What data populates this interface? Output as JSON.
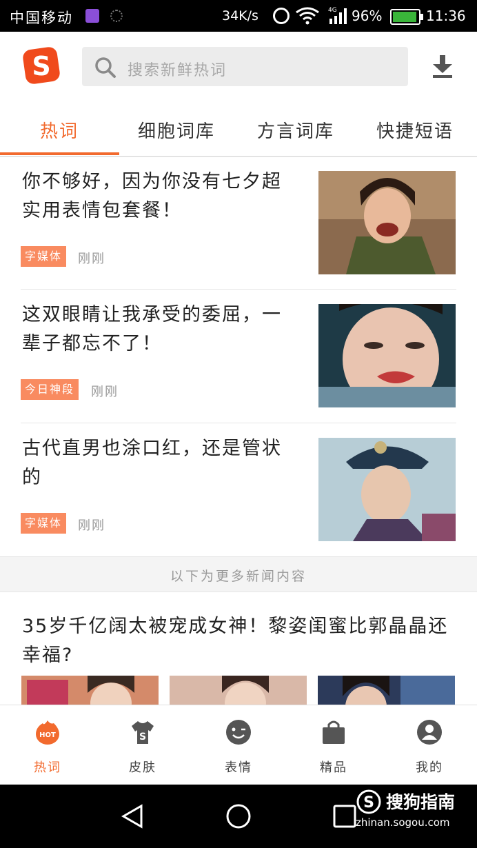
{
  "status_bar": {
    "carrier": "中国移动",
    "speed": "34K/s",
    "network": "4G",
    "battery": "96%",
    "time": "11:36"
  },
  "header": {
    "logo_letter": "S",
    "search_placeholder": "搜索新鲜热词"
  },
  "tabs": [
    "热词",
    "细胞词库",
    "方言词库",
    "快捷短语"
  ],
  "news": [
    {
      "title": "你不够好，因为你没有七夕超实用表情包套餐！",
      "tag": "字媒体",
      "time": "刚刚"
    },
    {
      "title": "这双眼睛让我承受的委屈，一辈子都忘不了！",
      "tag": "今日神段",
      "time": "刚刚"
    },
    {
      "title": "古代直男也涂口红，还是管状的",
      "tag": "字媒体",
      "time": "刚刚"
    }
  ],
  "more_label": "以下为更多新闻内容",
  "article2": {
    "title": "35岁千亿阔太被宠成女神！黎姿闺蜜比郭晶晶还幸福?"
  },
  "bottom_nav": [
    {
      "label": "热词",
      "icon": "hot-icon",
      "badge": "HOT"
    },
    {
      "label": "皮肤",
      "icon": "skin-tshirt-icon"
    },
    {
      "label": "表情",
      "icon": "emoji-wink-icon"
    },
    {
      "label": "精品",
      "icon": "shopping-bag-icon"
    },
    {
      "label": "我的",
      "icon": "profile-icon"
    }
  ],
  "watermark": {
    "name": "搜狗指南",
    "url": "zhinan.sogou.com"
  },
  "colors": {
    "accent": "#f26a2e",
    "tag_bg": "#f98b60"
  }
}
